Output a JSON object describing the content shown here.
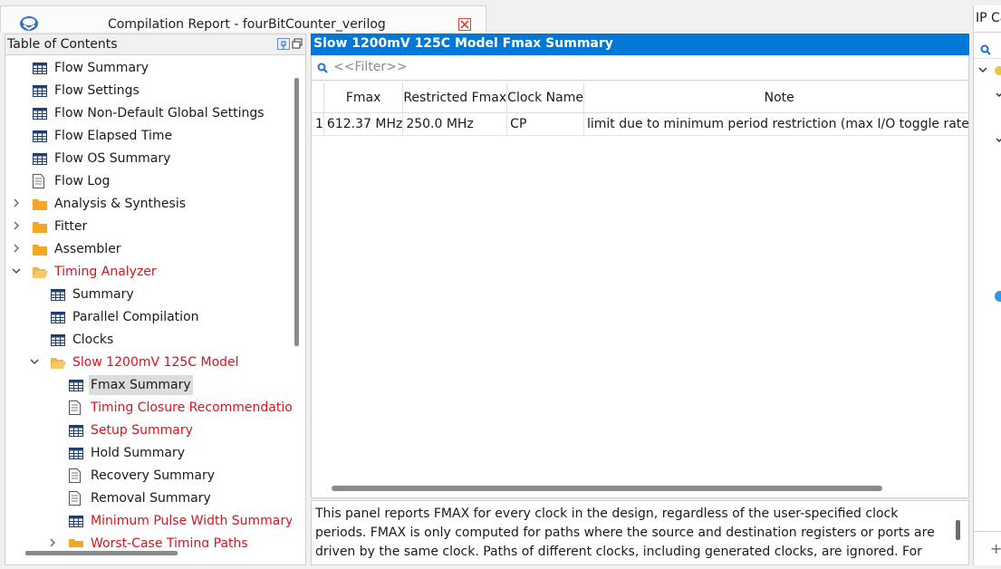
{
  "tab": {
    "title": "Compilation Report - fourBitCounter_verilog",
    "close_icon": "close-icon"
  },
  "toc": {
    "title": "Table of Contents",
    "items": [
      {
        "label": "Flow Summary",
        "icon": "table-icon",
        "color": "#1a1a1a"
      },
      {
        "label": "Flow Settings",
        "icon": "table-icon",
        "color": "#1a1a1a"
      },
      {
        "label": "Flow Non-Default Global Settings",
        "icon": "table-icon",
        "color": "#1a1a1a"
      },
      {
        "label": "Flow Elapsed Time",
        "icon": "table-icon",
        "color": "#1a1a1a"
      },
      {
        "label": "Flow OS Summary",
        "icon": "table-icon",
        "color": "#1a1a1a"
      },
      {
        "label": "Flow Log",
        "icon": "document-icon",
        "color": "#1a1a1a"
      },
      {
        "label": "Analysis & Synthesis",
        "icon": "folder-icon",
        "expandable": true,
        "expanded": false
      },
      {
        "label": "Fitter",
        "icon": "folder-icon",
        "expandable": true,
        "expanded": false
      },
      {
        "label": "Assembler",
        "icon": "folder-icon",
        "expandable": true,
        "expanded": false
      },
      {
        "label": "Timing Analyzer",
        "icon": "folder-open-icon",
        "expandable": true,
        "expanded": true,
        "color": "#d4141f"
      },
      {
        "label": "Summary",
        "icon": "table-icon"
      },
      {
        "label": "Parallel Compilation",
        "icon": "table-icon"
      },
      {
        "label": "Clocks",
        "icon": "table-icon"
      },
      {
        "label": "Slow 1200mV 125C Model",
        "icon": "folder-open-icon",
        "expandable": true,
        "expanded": true,
        "color": "#d4141f"
      },
      {
        "label": "Fmax Summary",
        "icon": "table-icon",
        "selected": true
      },
      {
        "label": "Timing Closure Recommendation",
        "icon": "document-icon",
        "color": "#d4141f"
      },
      {
        "label": "Setup Summary",
        "icon": "table-icon",
        "color": "#d4141f"
      },
      {
        "label": "Hold Summary",
        "icon": "table-icon"
      },
      {
        "label": "Recovery Summary",
        "icon": "document-icon"
      },
      {
        "label": "Removal Summary",
        "icon": "document-icon"
      },
      {
        "label": "Minimum Pulse Width Summary",
        "icon": "table-icon",
        "color": "#d4141f"
      },
      {
        "label": "Worst-Case Timing Paths",
        "icon": "folder-icon",
        "expandable": true,
        "expanded": false,
        "color": "#d4141f"
      }
    ]
  },
  "report": {
    "title": "Slow 1200mV 125C Model Fmax Summary",
    "filter_placeholder": "<<Filter>>",
    "columns": [
      "",
      "Fmax",
      "Restricted Fmax",
      "Clock Name",
      "Note"
    ],
    "rows": [
      [
        "1",
        "612.37 MHz",
        "250.0 MHz",
        "CP",
        "limit due to minimum period restriction (max I/O toggle rate)"
      ]
    ],
    "description": "This panel reports FMAX for every clock in the design, regardless of the user-specified clock periods. FMAX is only computed for paths where the source and destination registers or ports are driven by the same clock.  Paths of different clocks, including generated clocks, are ignored.  For paths between"
  },
  "ip_panel": {
    "title": "IP Catalog",
    "add_label": "+"
  },
  "colors": {
    "accent": "#0078d7",
    "error_red": "#d4141f",
    "folder": "#f5a623"
  }
}
